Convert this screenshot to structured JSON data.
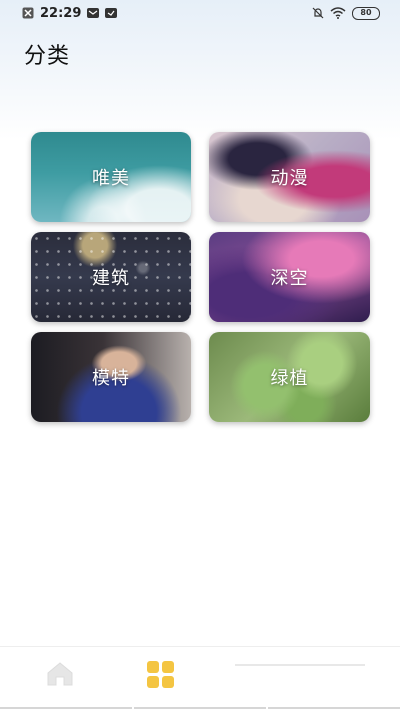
{
  "status_bar": {
    "time": "22:29",
    "battery": "80"
  },
  "header": {
    "title": "分类"
  },
  "categories": [
    {
      "label": "唯美"
    },
    {
      "label": "动漫"
    },
    {
      "label": "建筑"
    },
    {
      "label": "深空"
    },
    {
      "label": "模特"
    },
    {
      "label": "绿植"
    }
  ],
  "bottom_nav": {
    "items": [
      {
        "icon": "home-icon"
      },
      {
        "icon": "category-grid-icon"
      },
      {
        "icon": "profile-icon"
      }
    ],
    "accent": "#f4c542"
  }
}
